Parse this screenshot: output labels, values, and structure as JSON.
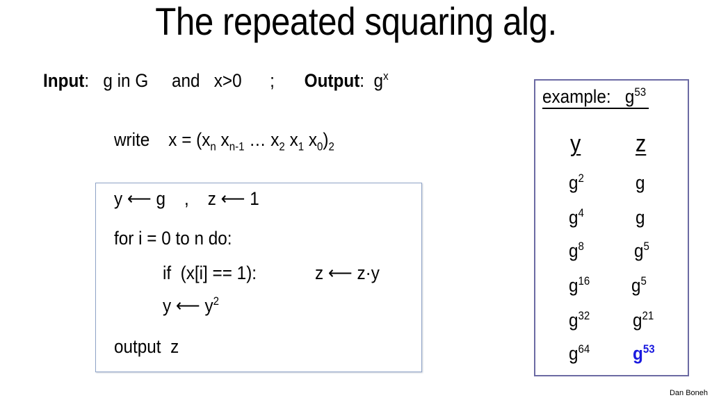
{
  "title": "The repeated squaring alg.",
  "io_line": {
    "input_label": "Input",
    "input_text": ":   g in G     and   x>0      ;",
    "output_label": "Output",
    "output_text": ":  g",
    "output_sup": "x"
  },
  "write_line": {
    "prefix": "write    x = (x",
    "parts": [
      {
        "sub": "n",
        "after": " x"
      },
      {
        "sub": "n-1",
        "after": " … x"
      },
      {
        "sub": "2",
        "after": " x"
      },
      {
        "sub": "1",
        "after": " x"
      },
      {
        "sub": "0",
        "after": ")"
      },
      {
        "sub": "2",
        "after": ""
      }
    ]
  },
  "algorithm": {
    "line1": "y ⟵ g    ,    z ⟵ 1",
    "line2": "for i = 0 to n do:",
    "line3_cond": "if  (x[i] == 1):",
    "line3_action": "z ⟵ z·y",
    "line4": "y ⟵ y",
    "line4_sup": "2",
    "line5": "output  z"
  },
  "example": {
    "label": "example:   g",
    "label_sup": "53",
    "col_y": "y",
    "col_z": "z",
    "rows": [
      {
        "y": "2",
        "z": ""
      },
      {
        "y": "4",
        "z": ""
      },
      {
        "y": "8",
        "z": "5"
      },
      {
        "y": "16",
        "z": "5"
      },
      {
        "y": "32",
        "z": "21"
      },
      {
        "y": "64",
        "z": "53"
      }
    ],
    "base": "g",
    "highlight_color": "#1a1adf"
  },
  "credit": "Dan Boneh"
}
